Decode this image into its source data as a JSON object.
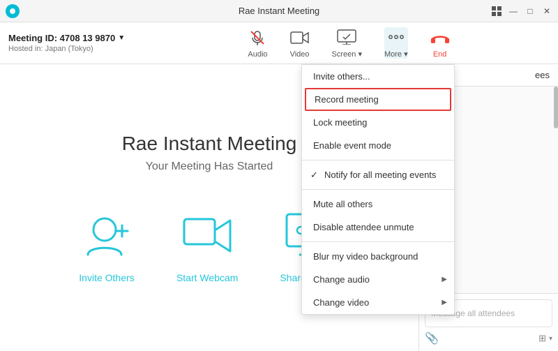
{
  "titleBar": {
    "title": "Rae Instant Meeting",
    "controls": [
      "grid-icon",
      "minimize-icon",
      "maximize-icon",
      "close-icon"
    ]
  },
  "toolbar": {
    "meetingId": "Meeting ID: 4708 13 9870",
    "dropdownArrow": "▼",
    "hostedIn": "Hosted in: Japan (Tokyo)",
    "buttons": [
      {
        "id": "audio",
        "label": "Audio",
        "muted": true
      },
      {
        "id": "video",
        "label": "Video"
      },
      {
        "id": "screen",
        "label": "Screen",
        "hasDropdown": true
      },
      {
        "id": "more",
        "label": "More",
        "hasDropdown": true,
        "active": true
      },
      {
        "id": "end",
        "label": "End",
        "isEnd": true
      }
    ]
  },
  "meeting": {
    "title": "Rae Instant Meeting",
    "subtitle": "Your Meeting Has Started"
  },
  "actions": [
    {
      "id": "invite",
      "label": "Invite Others",
      "icon": "person-add"
    },
    {
      "id": "webcam",
      "label": "Start Webcam",
      "icon": "video-camera"
    },
    {
      "id": "share",
      "label": "Share Screen",
      "icon": "share-screen"
    }
  ],
  "sidebar": {
    "attendeesLabel": "ees",
    "messagePlaceholder": "Message all attendees"
  },
  "dropdown": {
    "items": [
      {
        "id": "invite-others",
        "label": "Invite others...",
        "type": "normal"
      },
      {
        "id": "record-meeting",
        "label": "Record meeting",
        "type": "active"
      },
      {
        "id": "lock-meeting",
        "label": "Lock meeting",
        "type": "normal"
      },
      {
        "id": "enable-event-mode",
        "label": "Enable event mode",
        "type": "normal"
      },
      {
        "id": "separator1",
        "type": "separator"
      },
      {
        "id": "notify-events",
        "label": "Notify for all meeting events",
        "type": "check",
        "checked": true
      },
      {
        "id": "separator2",
        "type": "separator"
      },
      {
        "id": "mute-all",
        "label": "Mute all others",
        "type": "normal"
      },
      {
        "id": "disable-unmute",
        "label": "Disable attendee unmute",
        "type": "normal"
      },
      {
        "id": "separator3",
        "type": "separator"
      },
      {
        "id": "blur-background",
        "label": "Blur my video background",
        "type": "normal"
      },
      {
        "id": "change-audio",
        "label": "Change audio",
        "type": "submenu"
      },
      {
        "id": "change-video",
        "label": "Change video",
        "type": "submenu"
      }
    ]
  }
}
